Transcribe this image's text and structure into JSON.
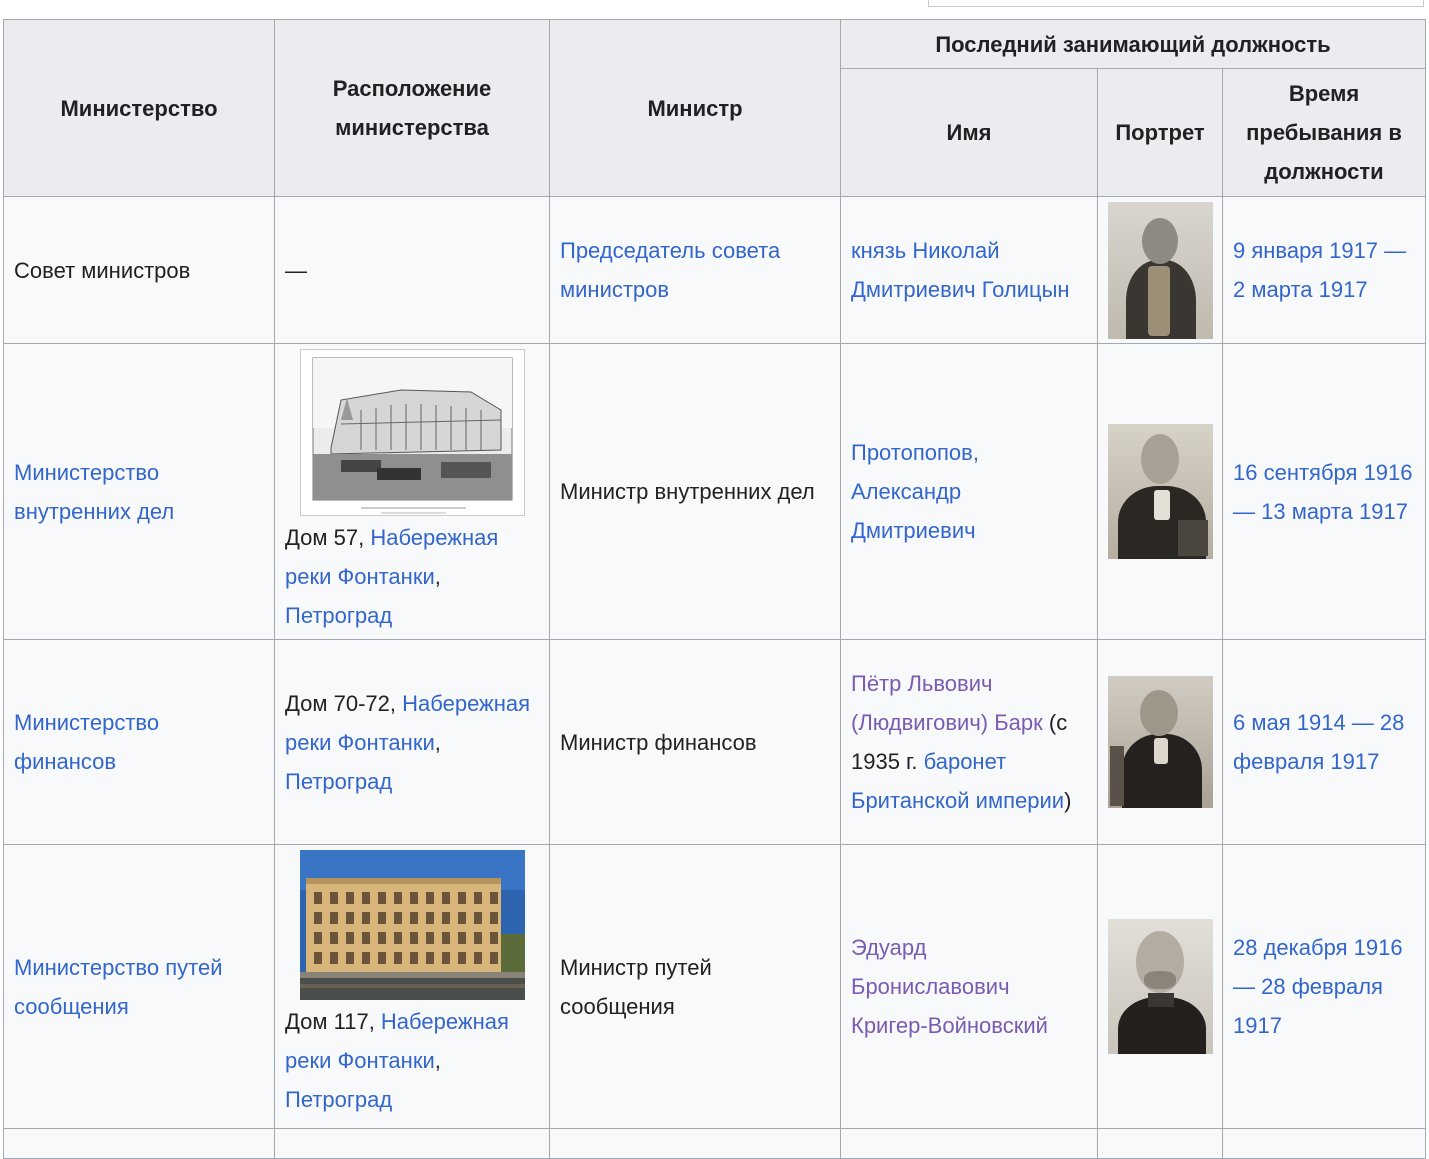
{
  "headers": {
    "ministry": "Министерство",
    "location": "Расположение министерства",
    "minister": "Министр",
    "last_holder_group": "Последний занимающий должность",
    "name": "Имя",
    "portrait": "Портрет",
    "tenure": "Время пребывания в должности"
  },
  "rows": [
    {
      "ministry": "Совет министров",
      "location_dash": "—",
      "minister": "Председатель совета министров",
      "name": "князь Николай Дмитриевич Голицын",
      "tenure": "9 января 1917 — 2 марта 1917",
      "portrait_icon": "portrait-golitsyn"
    },
    {
      "ministry": "Министерство внутренних дел",
      "location_prefix": "Дом 57, ",
      "location_link1": "Набережная реки Фонтанки",
      "location_sep": ", ",
      "location_link2": "Петроград",
      "minister": "Министр внутренних дел",
      "name": "Протопопов, Александр Дмитриевич",
      "tenure": "16 сентября 1916 — 13 марта 1917",
      "image_icon": "building-engraving",
      "portrait_icon": "portrait-protopopov"
    },
    {
      "ministry": "Министерство финансов",
      "location_prefix": "Дом 70-72, ",
      "location_link1": "Набережная реки Фонтанки",
      "location_sep": ", ",
      "location_link2": "Петроград",
      "minister": "Министр финансов",
      "name_link1": "Пётр Львович (Людвигович) Барк",
      "name_text1": " (с 1935 г. ",
      "name_link2": "баронет Британской империи",
      "name_text2": ")",
      "tenure": "6 мая 1914 — 28 февраля 1917",
      "portrait_icon": "portrait-bark"
    },
    {
      "ministry": "Министерство путей сообщения",
      "location_prefix": "Дом 117, ",
      "location_link1": "Набережная реки Фонтанки",
      "location_sep": ", ",
      "location_link2": "Петроград",
      "minister": "Министр путей сообщения",
      "name": "Эдуард Брониславович Кригер-Войновский",
      "tenure": "28 декабря 1916 — 28 февраля 1917",
      "image_icon": "building-photo",
      "portrait_icon": "portrait-kriger"
    }
  ],
  "colors": {
    "link": "#3366cc",
    "visited_link": "#795cb2",
    "header_bg": "#eaecf0",
    "cell_bg": "#f8f9fa",
    "border": "#a2a9b1"
  }
}
